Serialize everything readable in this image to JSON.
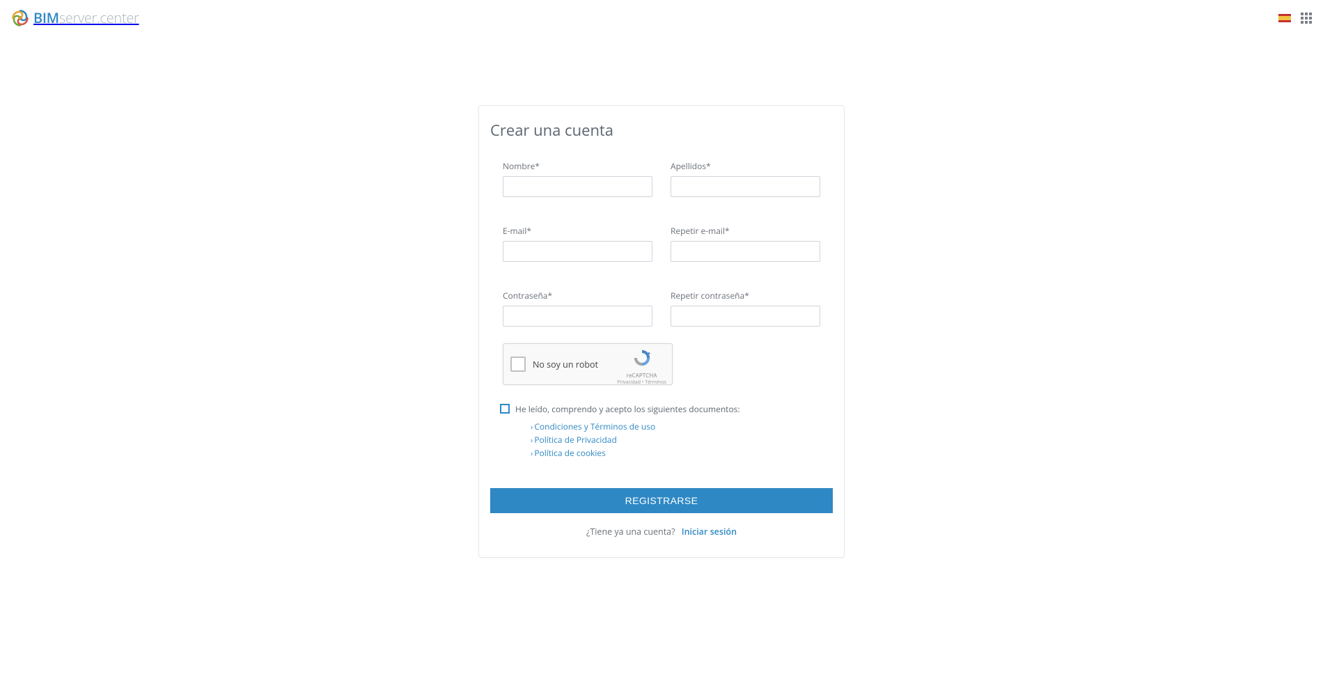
{
  "header": {
    "logo": {
      "bim": "BIM",
      "server": "server",
      "dot": ".",
      "center": "center"
    },
    "language_flag": "es"
  },
  "form": {
    "title": "Crear una cuenta",
    "fields": {
      "nombre_label": "Nombre*",
      "apellidos_label": "Apellidos*",
      "email_label": "E-mail*",
      "repeat_email_label": "Repetir e-mail*",
      "password_label": "Contraseña*",
      "repeat_password_label": "Repetir contraseña*"
    },
    "recaptcha": {
      "label": "No soy un robot",
      "brand": "reCAPTCHA",
      "links": "Privacidad • Términos"
    },
    "terms": {
      "accept_text": "He leído, comprendo y acepto los siguientes documentos:",
      "links": [
        "Condiciones y Términos de uso",
        "Política de Privacidad",
        "Política de cookies"
      ]
    },
    "submit_label": "REGISTRARSE",
    "login_prompt": "¿Tiene ya una cuenta?",
    "login_link": "Iniciar sesión"
  }
}
